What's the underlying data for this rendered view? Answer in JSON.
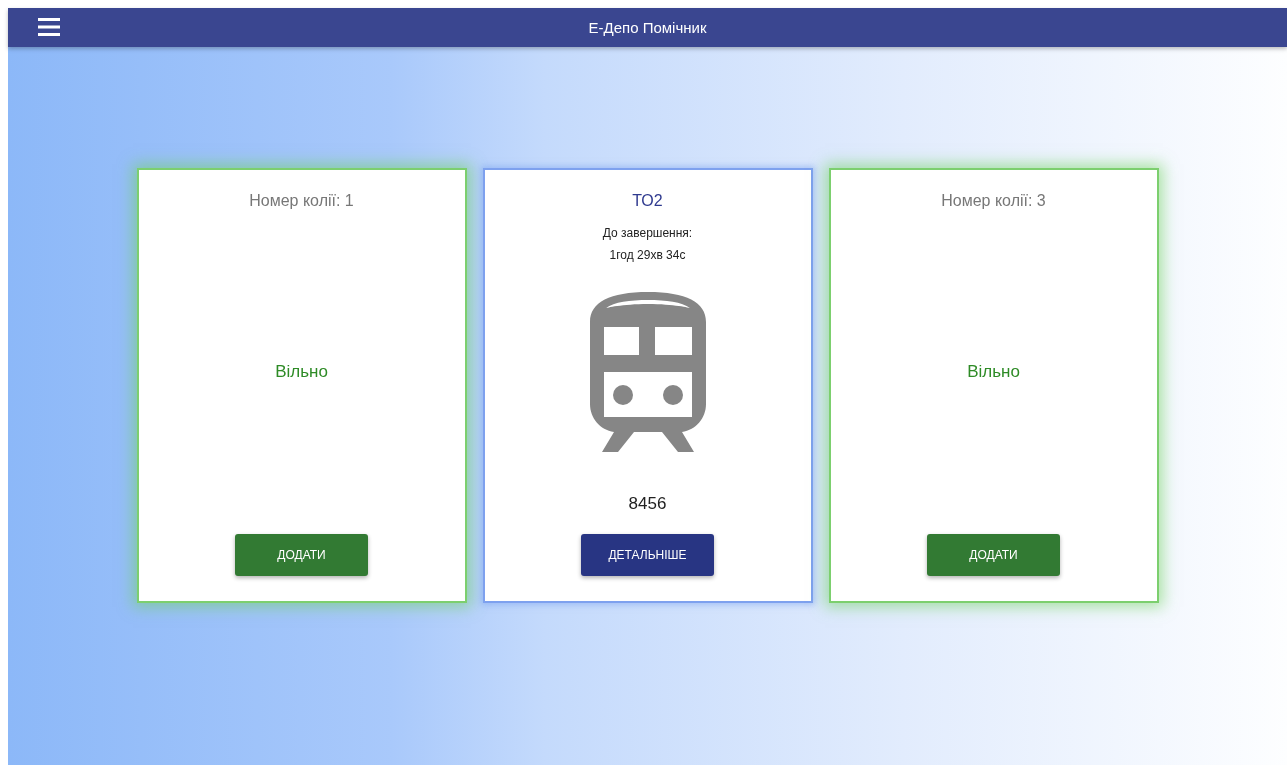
{
  "app_bar": {
    "title": "Е-Депо Помічник"
  },
  "tracks": [
    {
      "kind": "free",
      "title": "Номер колії: 1",
      "status": "Вільно",
      "button": "ДОДАТИ"
    },
    {
      "kind": "occupied",
      "title": "ТО2",
      "countdown_label": "До завершення:",
      "countdown": "1год 29хв 34с",
      "number": "8456",
      "button": "ДЕТАЛЬНІШЕ"
    },
    {
      "kind": "free",
      "title": "Номер колії: 3",
      "status": "Вільно",
      "button": "ДОДАТИ"
    }
  ]
}
